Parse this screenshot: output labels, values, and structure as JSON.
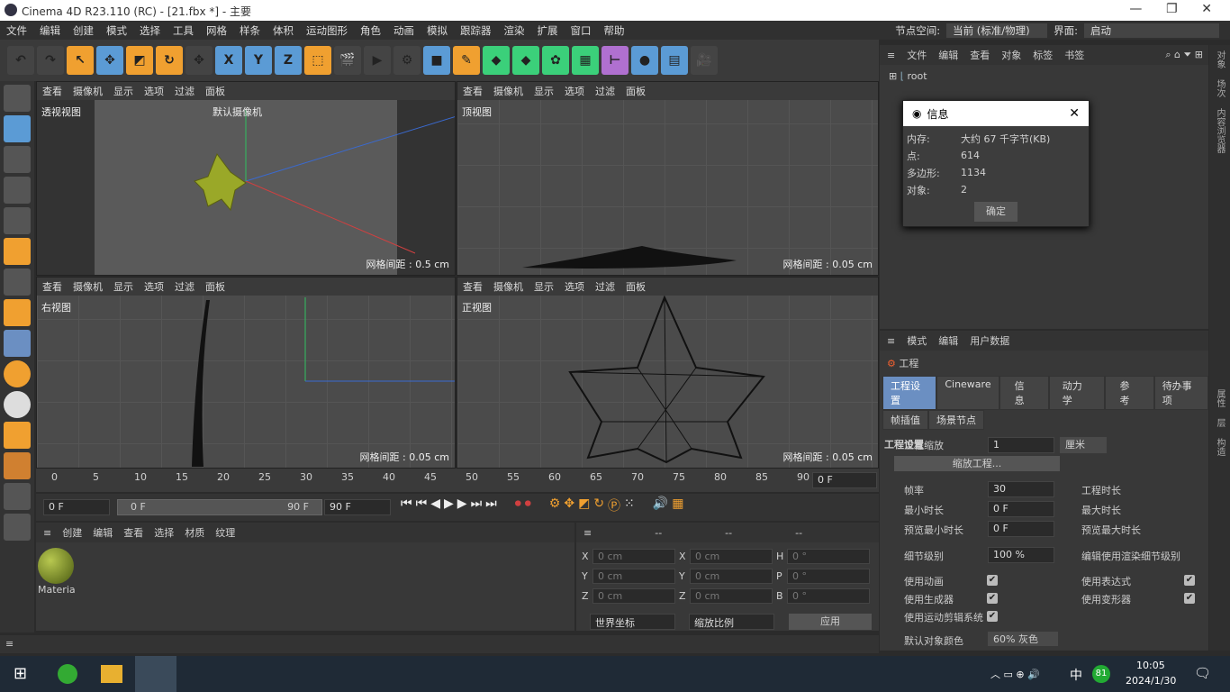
{
  "title": "Cinema 4D R23.110 (RC) - [21.fbx *] - 主要",
  "menu": [
    "文件",
    "编辑",
    "创建",
    "模式",
    "选择",
    "工具",
    "网格",
    "样条",
    "体积",
    "运动图形",
    "角色",
    "动画",
    "模拟",
    "跟踪器",
    "渲染",
    "扩展",
    "窗口",
    "帮助"
  ],
  "node_space": {
    "label": "节点空间:",
    "value": "当前 (标准/物理)"
  },
  "interface": {
    "label": "界面:",
    "value": "启动"
  },
  "viewport_menu": [
    "查看",
    "摄像机",
    "显示",
    "选项",
    "过滤",
    "面板"
  ],
  "viewports": [
    {
      "name": "透视视图",
      "camera": "默认摄像机",
      "spacing": "网格间距 : 0.5 cm"
    },
    {
      "name": "顶视图",
      "spacing": "网格间距 : 0.05 cm"
    },
    {
      "name": "右视图",
      "spacing": "网格间距 : 0.05 cm"
    },
    {
      "name": "正视图",
      "spacing": "网格间距 : 0.05 cm"
    }
  ],
  "timeline": {
    "ticks": [
      "0",
      "5",
      "10",
      "15",
      "20",
      "25",
      "30",
      "35",
      "40",
      "45",
      "50",
      "55",
      "60",
      "65",
      "70",
      "75",
      "80",
      "85",
      "90"
    ],
    "end_field": "0 F",
    "current": "0 F",
    "range_start": "0 F",
    "range_end": "90 F",
    "max": "90 F"
  },
  "material_manager": {
    "menu": [
      "创建",
      "编辑",
      "查看",
      "选择",
      "材质",
      "纹理"
    ],
    "material": "Materia",
    "material_color": "#7a9a2a"
  },
  "coords": {
    "headers": [
      "--",
      "--",
      "--"
    ],
    "rows": [
      [
        "X",
        "0 cm",
        "X",
        "0 cm",
        "H",
        "0 °"
      ],
      [
        "Y",
        "0 cm",
        "Y",
        "0 cm",
        "P",
        "0 °"
      ],
      [
        "Z",
        "0 cm",
        "Z",
        "0 cm",
        "B",
        "0 °"
      ]
    ],
    "world": "世界坐标",
    "scale": "缩放比例",
    "apply": "应用"
  },
  "object_manager": {
    "menu": [
      "文件",
      "编辑",
      "查看",
      "对象",
      "标签",
      "书签"
    ],
    "root": "root"
  },
  "dialog": {
    "title": "信息",
    "rows": [
      [
        "内存:",
        "大约 67 千字节(KB)"
      ],
      [
        "点:",
        "614"
      ],
      [
        "多边形:",
        "1134"
      ],
      [
        "对象:",
        "2"
      ]
    ],
    "ok": "确定"
  },
  "attributes": {
    "menu": [
      "模式",
      "编辑",
      "用户数据"
    ],
    "object": "工程",
    "tabs": [
      "工程设置",
      "Cineware",
      "信息",
      "动力学",
      "参考",
      "待办事项"
    ],
    "tabs2": [
      "帧插值",
      "场景节点"
    ],
    "section": "工程设置",
    "scale_label": "工程缩放",
    "scale_value": "1",
    "unit": "厘米",
    "scale_button": "缩放工程...",
    "fps_label": "帧率",
    "fps": "30",
    "proj_len": "工程时长",
    "min_label": "最小时长",
    "min": "0 F",
    "max_label": "最大时长",
    "pmin_label": "预览最小时长",
    "pmin": "0 F",
    "pmax_label": "预览最大时长",
    "lod_label": "细节级别",
    "lod": "100 %",
    "render_lod": "编辑使用渲染细节级别",
    "checks": [
      "使用动画",
      "使用表达式",
      "使用生成器",
      "使用变形器",
      "使用运动剪辑系统"
    ],
    "color_label": "默认对象颜色",
    "color_value": "60% 灰色"
  },
  "right_tabs": [
    "对象",
    "场次",
    "内容浏览器",
    "属性",
    "层",
    "构造"
  ],
  "taskbar": {
    "time": "10:05",
    "date": "2024/1/30",
    "ime": "中",
    "badge": "81"
  },
  "accent": "#f0a030"
}
